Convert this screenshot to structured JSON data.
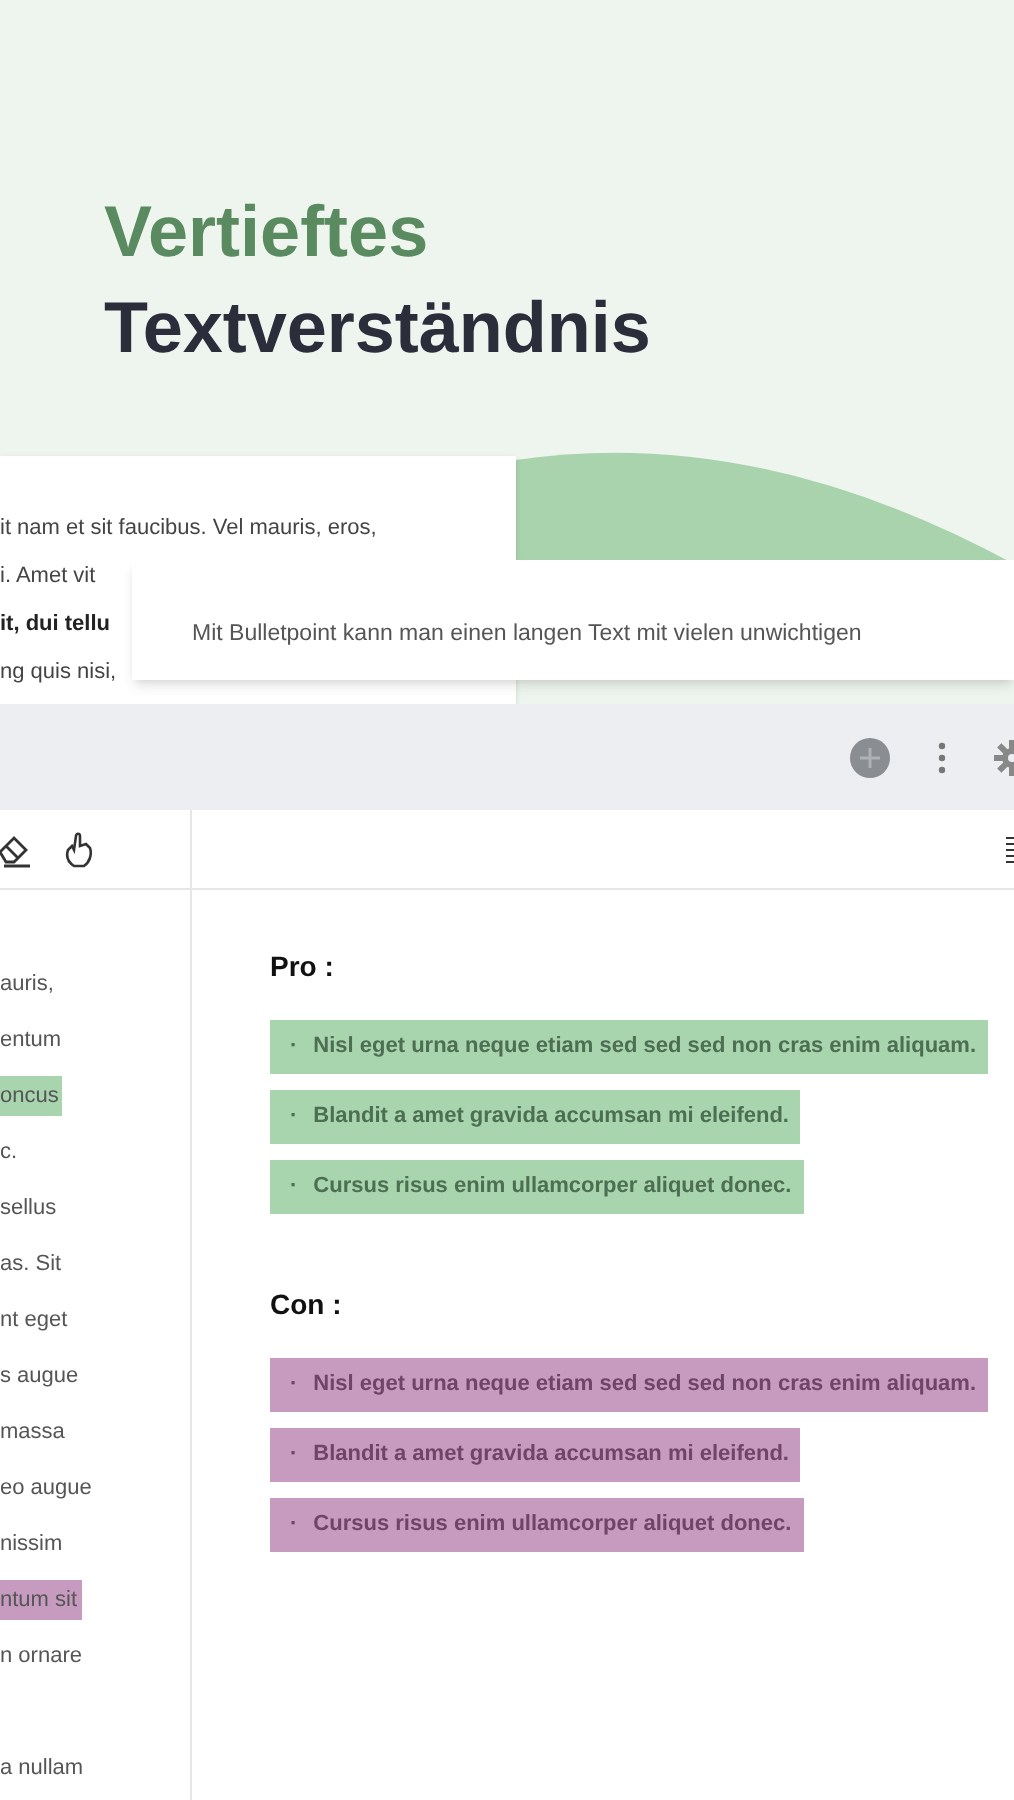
{
  "hero": {
    "title_line_1": "Vertieftes",
    "title_line_2": "Textverständnis"
  },
  "back_card": {
    "lines": [
      {
        "text": "it nam et sit faucibus. Vel mauris, eros,",
        "bold": false
      },
      {
        "text": "i. Amet vit",
        "bold": false
      },
      {
        "text": "it, dui tellu",
        "bold": true
      },
      {
        "text": "ng quis nisi,",
        "bold": false
      }
    ]
  },
  "front_card": {
    "lines": [
      "Mit Bulletpoint kann man einen langen Text mit vielen unwichtigen"
    ]
  },
  "editor": {
    "left_lines": [
      {
        "text": "auris,"
      },
      {
        "text": "entum"
      },
      {
        "text": "oncus",
        "color": "#a8d5ae"
      },
      {
        "text": "c."
      },
      {
        "text": "sellus"
      },
      {
        "text": "as. Sit"
      },
      {
        "text": "nt eget"
      },
      {
        "text": "s augue"
      },
      {
        "text": "massa"
      },
      {
        "text": "eo augue"
      },
      {
        "text": "nissim"
      },
      {
        "text": "ntum sit",
        "color": "#c79bbf"
      },
      {
        "text": "n ornare"
      },
      {
        "text": "a nullam",
        "gap_before": true
      }
    ],
    "sections": [
      {
        "heading": "Pro :",
        "color": "#a8d5ae",
        "items": [
          "Nisl eget urna neque etiam sed sed sed non cras enim aliquam.",
          "Blandit a amet gravida accumsan mi eleifend.",
          "Cursus risus enim ullamcorper aliquet donec."
        ]
      },
      {
        "heading": "Con :",
        "color": "#c79bbf",
        "items": [
          "Nisl eget urna neque etiam sed sed sed non cras enim aliquam.",
          "Blandit a amet gravida accumsan mi eleifend.",
          "Cursus risus enim ullamcorper aliquet donec."
        ]
      }
    ],
    "bullet": "·"
  }
}
